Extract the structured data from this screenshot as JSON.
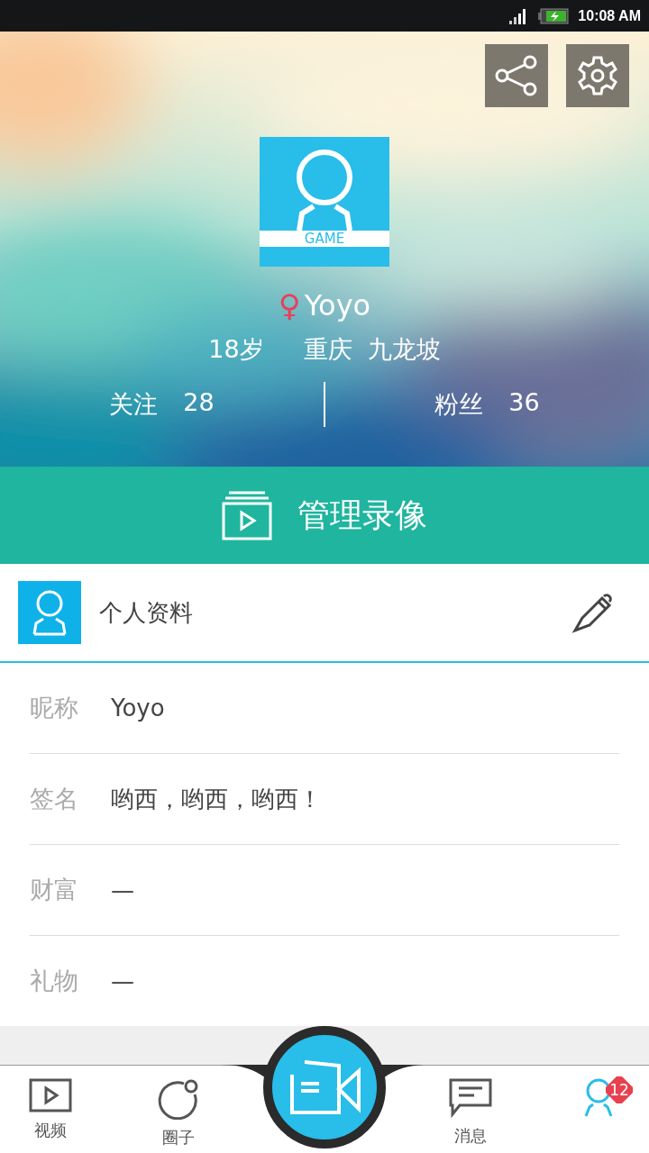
{
  "status_bar": {
    "time": "10:08 AM"
  },
  "profile": {
    "avatar_caption": "GAME",
    "name": "Yoyo",
    "gender_mark": "♀",
    "age": "18岁",
    "city": "重庆",
    "district": "九龙坡",
    "stats": [
      {
        "label": "关注",
        "value": "28"
      },
      {
        "label": "粉丝",
        "value": "36"
      }
    ]
  },
  "manage_button": {
    "label": "管理录像"
  },
  "details": {
    "title": "个人资料",
    "fields": [
      {
        "label": "昵称",
        "value": "Yoyo"
      },
      {
        "label": "签名",
        "value": "哟西，哟西，哟西！"
      },
      {
        "label": "财富",
        "value": "—"
      },
      {
        "label": "礼物",
        "value": "—"
      }
    ]
  },
  "nav": {
    "items": [
      {
        "kind": "video",
        "label": "视频",
        "selected": false
      },
      {
        "kind": "circle",
        "label": "圈子",
        "selected": false
      },
      {
        "kind": "record",
        "selected": false
      },
      {
        "kind": "messages",
        "label": "消息",
        "selected": false
      },
      {
        "kind": "profile",
        "badge": "12",
        "selected": true
      }
    ]
  }
}
